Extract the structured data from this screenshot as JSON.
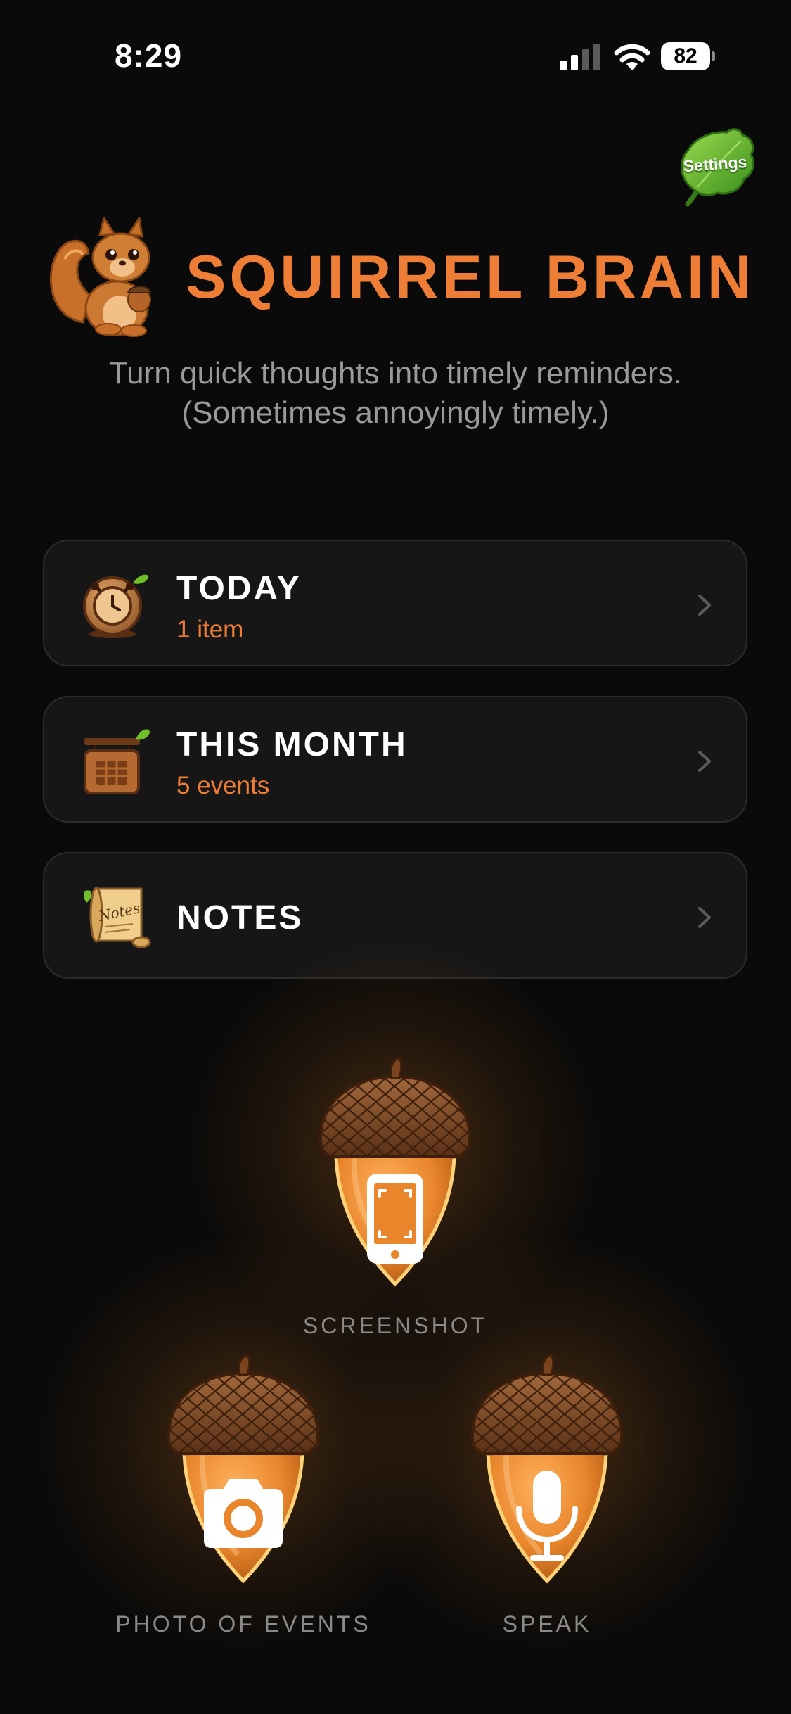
{
  "status_bar": {
    "time": "8:29",
    "battery_level": "82"
  },
  "settings": {
    "label": "Settings"
  },
  "header": {
    "title": "SQUIRREL BRAIN",
    "subtitle_line1": "Turn quick thoughts into timely reminders.",
    "subtitle_line2": "(Sometimes annoyingly timely.)"
  },
  "rows": [
    {
      "title": "TODAY",
      "subtitle": "1 item",
      "icon": "alarm-clock-icon"
    },
    {
      "title": "THIS MONTH",
      "subtitle": "5 events",
      "icon": "calendar-sign-icon"
    },
    {
      "title": "NOTES",
      "subtitle": "",
      "icon": "notes-scroll-icon",
      "icon_text": "Notes"
    }
  ],
  "actions": {
    "screenshot": {
      "label": "SCREENSHOT",
      "icon": "phone-screenshot-icon"
    },
    "photo": {
      "label": "PHOTO OF EVENTS",
      "icon": "camera-icon"
    },
    "speak": {
      "label": "SPEAK",
      "icon": "microphone-icon"
    }
  },
  "colors": {
    "accent": "#ee7e35",
    "background": "#0a0a0a",
    "row_background": "#161616",
    "muted_text": "#9a9a9a"
  }
}
